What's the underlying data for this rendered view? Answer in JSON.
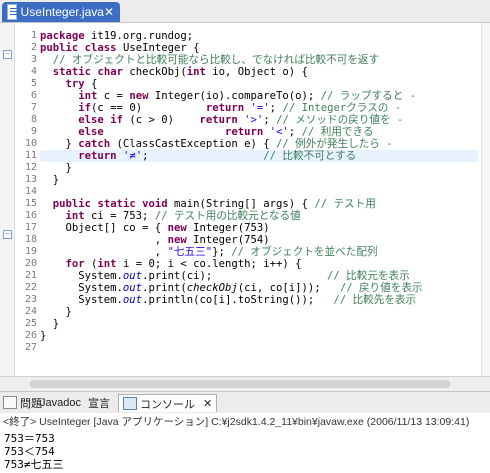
{
  "editor_tab": {
    "file_name": "UseInteger.java",
    "close_glyph": "✕"
  },
  "line_numbers": [
    "1",
    "2",
    "3",
    "4",
    "5",
    "6",
    "7",
    "8",
    "9",
    "10",
    "11",
    "12",
    "13",
    "14",
    "15",
    "16",
    "17",
    "18",
    "19",
    "20",
    "21",
    "22",
    "23",
    "24",
    "25",
    "26",
    "27"
  ],
  "code": {
    "l1_kw": "package",
    "l1_rest": " it19.org.rundog;",
    "l2_kw1": "public",
    "l2_kw2": "class",
    "l2_rest": " UseInteger {",
    "l3_cm": "  // オブジェクトと比較可能なら比較し、でなければ比較不可を返す",
    "l4_kw1": "static",
    "l4_kw2": "char",
    "l4_a": " checkObj(",
    "l4_kw3": "int",
    "l4_b": " io, Object o) {",
    "l5_kw": "try",
    "l5_rest": " {",
    "l6_kw1": "int",
    "l6_a": " c = ",
    "l6_kw2": "new",
    "l6_b": " Integer(io).compareTo(o); ",
    "l6_cm": "// ラップすると -",
    "l7_kw1": "if",
    "l7_a": "(c == 0)          ",
    "l7_kw2": "return",
    "l7_b": " ",
    "l7_st": "'='",
    "l7_c": "; ",
    "l7_cm": "// Integerクラスの -",
    "l8_kw1": "else",
    "l8_kw2": "if",
    "l8_a": " (c > 0)    ",
    "l8_kw3": "return",
    "l8_b": " ",
    "l8_st": "'>'",
    "l8_c": "; ",
    "l8_cm": "// メソッドの戻り値を -",
    "l9_kw1": "else",
    "l9_a": "                   ",
    "l9_kw2": "return",
    "l9_b": " ",
    "l9_st": "'<'",
    "l9_c": "; ",
    "l9_cm": "// 利用できる",
    "l10_a": "    } ",
    "l10_kw": "catch",
    "l10_b": " (ClassCastException e) { ",
    "l10_cm": "// 例外が発生したら -",
    "l11_kw": "return",
    "l11_b": " ",
    "l11_st": "'≠'",
    "l11_c": ";                  ",
    "l11_cm": "// 比較不可とする",
    "l12": "    }",
    "l13": "  }",
    "l15_kw1": "public",
    "l15_kw2": "static",
    "l15_kw3": "void",
    "l15_a": " main(String[] args) { ",
    "l15_cm": "// テスト用",
    "l16_kw": "int",
    "l16_a": " ci = 753; ",
    "l16_cm": "// テスト用の比較元となる値",
    "l17_a": "    Object[] co = { ",
    "l17_kw": "new",
    "l17_b": " Integer(753)",
    "l18_a": "                  , ",
    "l18_kw": "new",
    "l18_b": " Integer(754)",
    "l19_a": "                  , ",
    "l19_st": "\"七五三\"",
    "l19_b": "}; ",
    "l19_cm": "// オブジェクトを並べた配列",
    "l20_kw1": "for",
    "l20_a": " (",
    "l20_kw2": "int",
    "l20_b": " i = 0; i < co.length; i++) {",
    "l21_a": "      System.",
    "l21_fd": "out",
    "l21_b": ".print(ci);                  ",
    "l21_cm": "// 比較元を表示",
    "l22_a": "      System.",
    "l22_fd": "out",
    "l22_b": ".print(",
    "l22_it": "checkObj",
    "l22_c": "(ci, co[i]));   ",
    "l22_cm": "// 戻り値を表示",
    "l23_a": "      System.",
    "l23_fd": "out",
    "l23_b": ".println(co[i].toString());   ",
    "l23_cm": "// 比較先を表示",
    "l24": "    }",
    "l25": "  }",
    "l26": "}"
  },
  "views": {
    "problems": "問題",
    "javadoc": "Javadoc",
    "declaration": "宣言",
    "console": "コンソール",
    "close_glyph": "✕"
  },
  "console": {
    "title": "<終了> UseInteger [Java アプリケーション] C:¥j2sdk1.4.2_11¥bin¥javaw.exe (2006/11/13 13:09:41)",
    "output": [
      "753＝753",
      "753＜754",
      "753≠七五三"
    ]
  }
}
